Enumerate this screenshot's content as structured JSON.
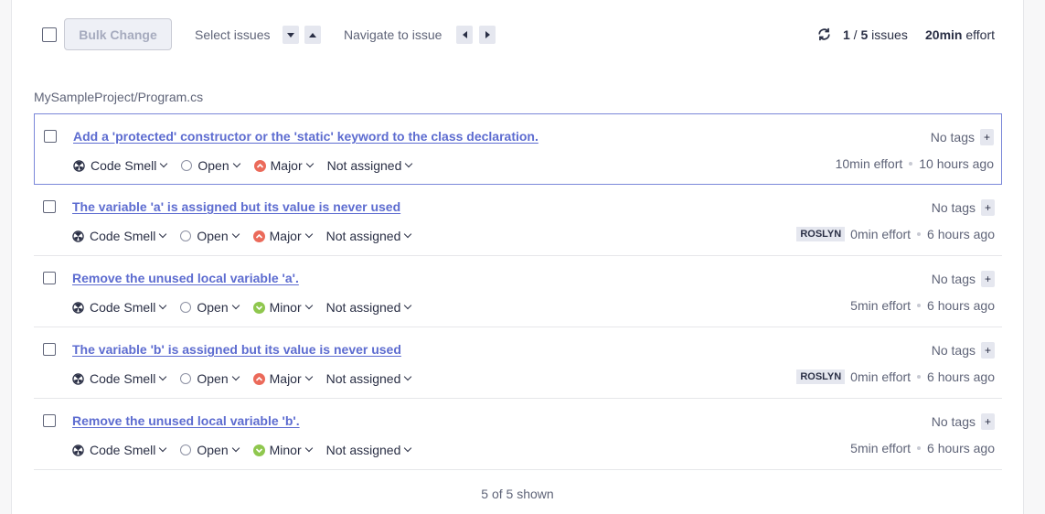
{
  "toolbar": {
    "bulk_change_label": "Bulk Change",
    "select_issues_label": "Select issues",
    "navigate_label": "Navigate to issue",
    "count_current": "1",
    "count_sep": " / ",
    "count_total": "5",
    "count_suffix": " issues",
    "effort_value": "20min",
    "effort_suffix": " effort"
  },
  "file_path": "MySampleProject/Program.cs",
  "colors": {
    "accent": "#5d6cd0",
    "major": "#eb6a5a",
    "minor": "#8fc74e"
  },
  "issues": [
    {
      "title": "Add a 'protected' constructor or the 'static' keyword to the class declaration.",
      "type": "Code Smell",
      "type_icon": "code-smell-icon",
      "status": "Open",
      "severity": "Major",
      "assignee": "Not assigned",
      "tags": "No tags",
      "tag_add": "+",
      "rule_badge": "",
      "effort": "10min effort",
      "time": "10 hours ago"
    },
    {
      "title": "The variable 'a' is assigned but its value is never used",
      "type": "Code Smell",
      "type_icon": "code-smell-icon",
      "status": "Open",
      "severity": "Major",
      "assignee": "Not assigned",
      "tags": "No tags",
      "tag_add": "+",
      "rule_badge": "ROSLYN",
      "effort": "0min effort",
      "time": "6 hours ago"
    },
    {
      "title": "Remove the unused local variable 'a'.",
      "type": "Code Smell",
      "type_icon": "code-smell-icon",
      "status": "Open",
      "severity": "Minor",
      "assignee": "Not assigned",
      "tags": "No tags",
      "tag_add": "+",
      "rule_badge": "",
      "effort": "5min effort",
      "time": "6 hours ago"
    },
    {
      "title": "The variable 'b' is assigned but its value is never used",
      "type": "Code Smell",
      "type_icon": "code-smell-icon",
      "status": "Open",
      "severity": "Major",
      "assignee": "Not assigned",
      "tags": "No tags",
      "tag_add": "+",
      "rule_badge": "ROSLYN",
      "effort": "0min effort",
      "time": "6 hours ago"
    },
    {
      "title": "Remove the unused local variable 'b'.",
      "type": "Code Smell",
      "type_icon": "code-smell-icon",
      "status": "Open",
      "severity": "Minor",
      "assignee": "Not assigned",
      "tags": "No tags",
      "tag_add": "+",
      "rule_badge": "",
      "effort": "5min effort",
      "time": "6 hours ago"
    }
  ],
  "footer": {
    "shown_text": "5 of 5 shown"
  }
}
